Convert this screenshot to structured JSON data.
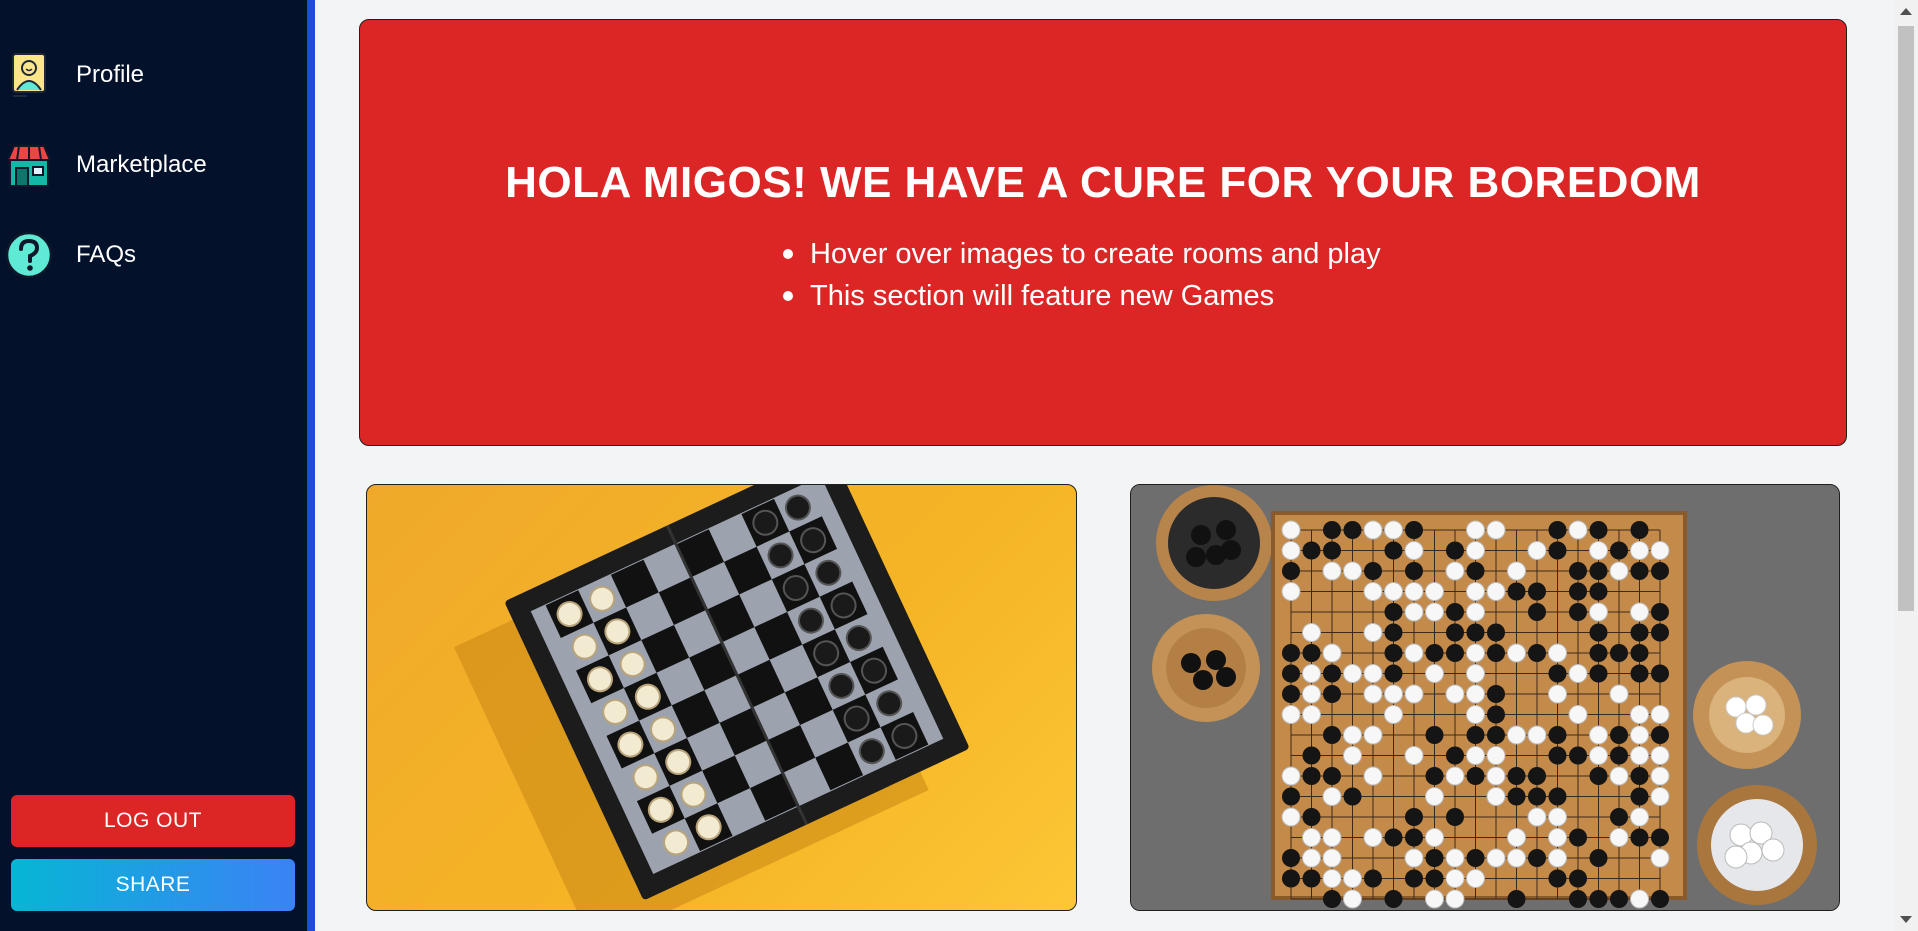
{
  "sidebar": {
    "items": [
      {
        "label": "Profile",
        "icon": "profile-icon"
      },
      {
        "label": "Marketplace",
        "icon": "marketplace-icon"
      },
      {
        "label": "FAQs",
        "icon": "faq-icon"
      }
    ],
    "logout_label": "LOG OUT",
    "share_label": "SHARE"
  },
  "banner": {
    "title": "HOLA MIGOS! WE HAVE A CURE FOR YOUR BOREDOM",
    "bullets": [
      "Hover over images to create rooms and play",
      "This section will feature new Games"
    ]
  },
  "games": [
    {
      "image": "chess-board-image"
    },
    {
      "image": "go-board-image"
    }
  ],
  "colors": {
    "sidebar_bg": "#03112a",
    "accent_red": "#dc2626",
    "share_gradient_start": "#06b6d4",
    "share_gradient_end": "#3b82f6",
    "page_bg": "#f3f4f6"
  }
}
